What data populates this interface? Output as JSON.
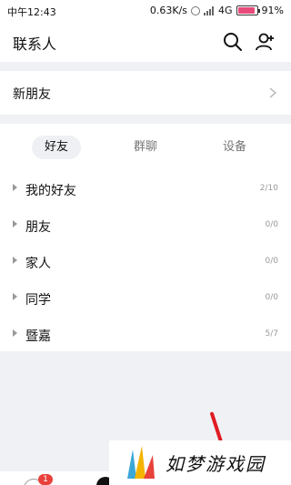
{
  "status_bar": {
    "time": "中午12:43",
    "speed": "0.63K/s",
    "network": "4G",
    "battery": "91%",
    "battery_level": 0.91
  },
  "header": {
    "title": "联系人",
    "search_icon": "search-icon",
    "add_friend_icon": "add-friend-icon"
  },
  "new_friends": {
    "label": "新朋友",
    "arrow_icon": "chevron-right-icon"
  },
  "tabs": [
    "好友",
    "群聊",
    "设备"
  ],
  "groups": [
    {
      "name": "我的好友",
      "count": "2/10"
    },
    {
      "name": "朋友",
      "count": "0/0"
    },
    {
      "name": "家人",
      "count": "0/0"
    },
    {
      "name": "同学",
      "count": "0/0"
    },
    {
      "name": "暨嘉",
      "count": "5/7"
    }
  ],
  "tabbar": {
    "badge": "1"
  },
  "watermark": {
    "text": "如梦游戏园"
  },
  "colors": {
    "accent_red": "#e8413b",
    "battery_pink": "#e84b7a"
  }
}
